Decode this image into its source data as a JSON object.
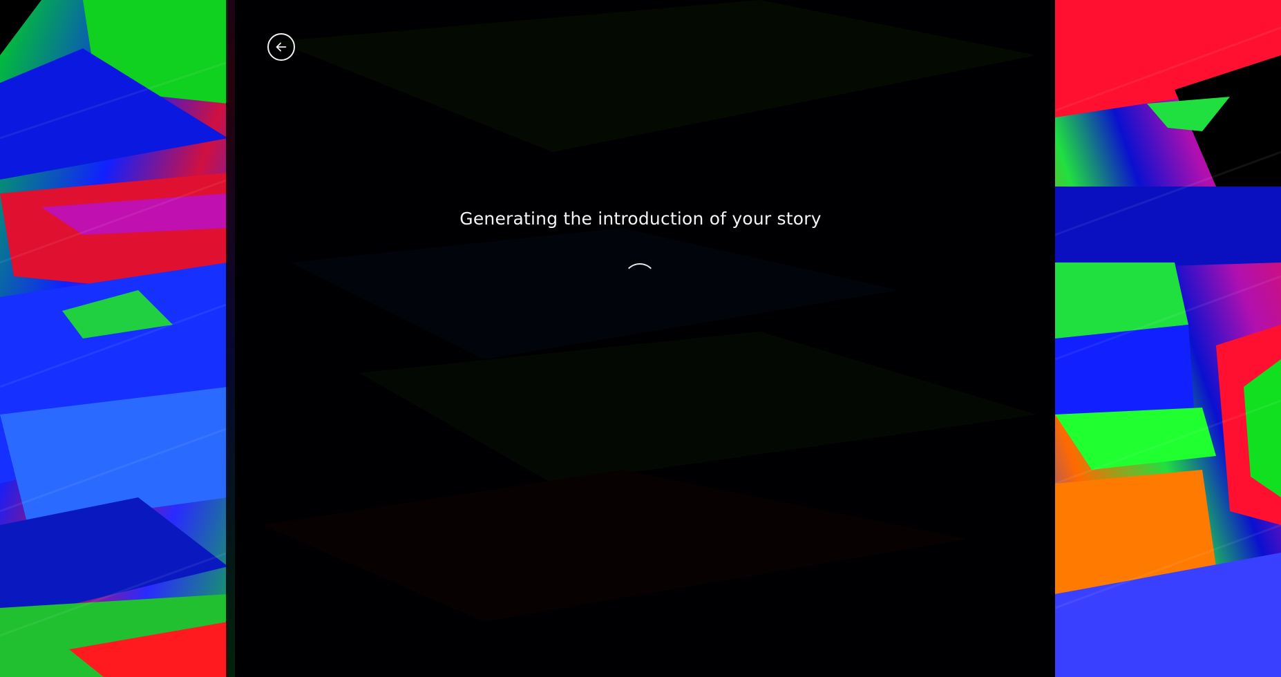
{
  "nav": {
    "back_icon": "arrow-left-icon",
    "icon_color": "#f2f2f2"
  },
  "loading": {
    "message": "Generating the introduction of your story",
    "indicator": "spinner",
    "text_color": "#f4f4f4"
  },
  "background": {
    "style": "abstract glitch art",
    "colors": [
      "#0a1aff",
      "#00e020",
      "#ff0a1e",
      "#c020c0",
      "#ff7a00"
    ],
    "overlay_color": "#000000"
  }
}
